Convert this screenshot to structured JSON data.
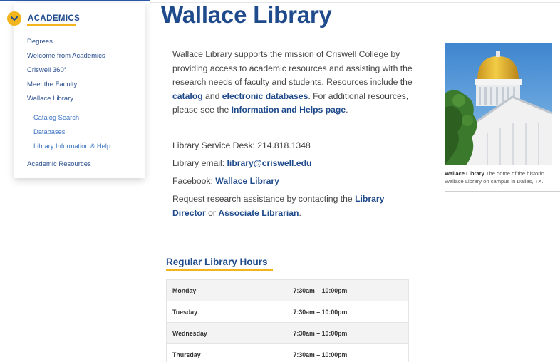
{
  "sidebar": {
    "title": "ACADEMICS",
    "items": [
      {
        "label": "Degrees"
      },
      {
        "label": "Welcome from Academics"
      },
      {
        "label": "Criswell 360°"
      },
      {
        "label": "Meet the Faculty"
      },
      {
        "label": "Wallace Library"
      }
    ],
    "subitems": [
      {
        "label": "Catalog Search"
      },
      {
        "label": "Databases"
      },
      {
        "label": "Library Information & Help"
      }
    ],
    "last_item": {
      "label": "Academic Resources"
    }
  },
  "main": {
    "title": "Wallace Library",
    "intro": {
      "p1": "Wallace Library supports the mission of Criswell College by providing access to academic resources and assisting with the research needs of faculty and students. Resources include the ",
      "link_catalog": "catalog",
      "and": " and ",
      "link_databases": "electronic databases",
      "p2": ". For additional resources, please see the ",
      "link_info": "Information and Helps page",
      "p3": "."
    },
    "desk": "Library Service Desk: 214.818.1348",
    "email_label": "Library email: ",
    "email_link": "library@criswell.edu",
    "facebook_label": "Facebook: ",
    "facebook_link": "Wallace Library",
    "request_text": "Request research assistance by contacting the ",
    "request_link1": "Library Director",
    "request_or": " or ",
    "request_link2": "Associate Librarian",
    "request_end": "."
  },
  "figure": {
    "caption_bold": "Wallace Library",
    "caption_text": " The dome of the historic Wallace Library on campus in Dallas, TX."
  },
  "hours": {
    "title": "Regular Library Hours",
    "rows": [
      {
        "day": "Monday",
        "time": "7:30am – 10:00pm"
      },
      {
        "day": "Tuesday",
        "time": "7:30am – 10:00pm"
      },
      {
        "day": "Wednesday",
        "time": "7:30am – 10:00pm"
      },
      {
        "day": "Thursday",
        "time": "7:30am – 10:00pm"
      }
    ]
  },
  "colors": {
    "brand_blue": "#1f4a8b",
    "accent_gold": "#f2b51d",
    "sky": "#5f9fd6"
  }
}
